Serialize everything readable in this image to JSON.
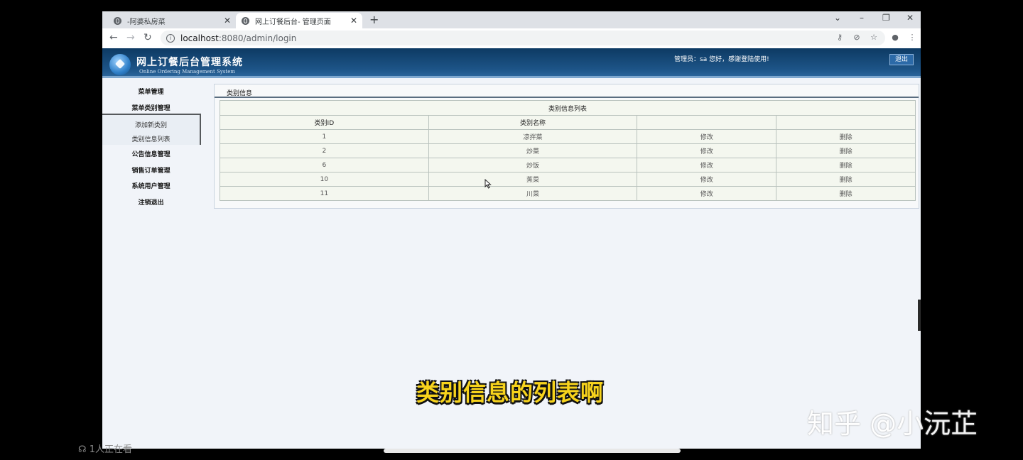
{
  "browser": {
    "tabs": [
      {
        "title": "-阿婆私房菜",
        "active": false
      },
      {
        "title": "网上订餐后台- 管理页面",
        "active": true
      }
    ],
    "new_tab": "+",
    "url_host": "localhost",
    "url_path": ":8080/admin/login",
    "window_controls": {
      "minimize": "–",
      "restore": "❐",
      "close": "✕",
      "tab_search": "⌄"
    }
  },
  "app": {
    "title": "网上订餐后台管理系统",
    "subtitle": "Online Ordering Management System",
    "user_info": "管理员：sa 您好，感谢登陆使用!",
    "logout": "退出",
    "accent": "#1d5487"
  },
  "sidebar": {
    "items": [
      {
        "label": "菜单管理"
      },
      {
        "label": "菜单类别管理"
      },
      {
        "label": "公告信息管理"
      },
      {
        "label": "销售订单管理"
      },
      {
        "label": "系统用户管理"
      },
      {
        "label": "注销退出"
      }
    ],
    "submenu": [
      {
        "label": "添加新类别"
      },
      {
        "label": "类别信息列表"
      }
    ]
  },
  "content": {
    "panel_title": "类别信息",
    "table_caption": "类别信息列表",
    "columns": [
      "类别ID",
      "类别名称",
      "",
      ""
    ],
    "rows": [
      {
        "id": "1",
        "name": "凉拌菜",
        "edit": "修改",
        "delete": "删除"
      },
      {
        "id": "2",
        "name": "炒菜",
        "edit": "修改",
        "delete": "删除"
      },
      {
        "id": "6",
        "name": "炒饭",
        "edit": "修改",
        "delete": "删除"
      },
      {
        "id": "10",
        "name": "蒸菜",
        "edit": "修改",
        "delete": "删除"
      },
      {
        "id": "11",
        "name": "川菜",
        "edit": "修改",
        "delete": "删除"
      }
    ]
  },
  "overlay": {
    "subtitle": "类别信息的列表啊",
    "watermark": "知乎 @小沅芷",
    "viewers": "1人正在看"
  }
}
